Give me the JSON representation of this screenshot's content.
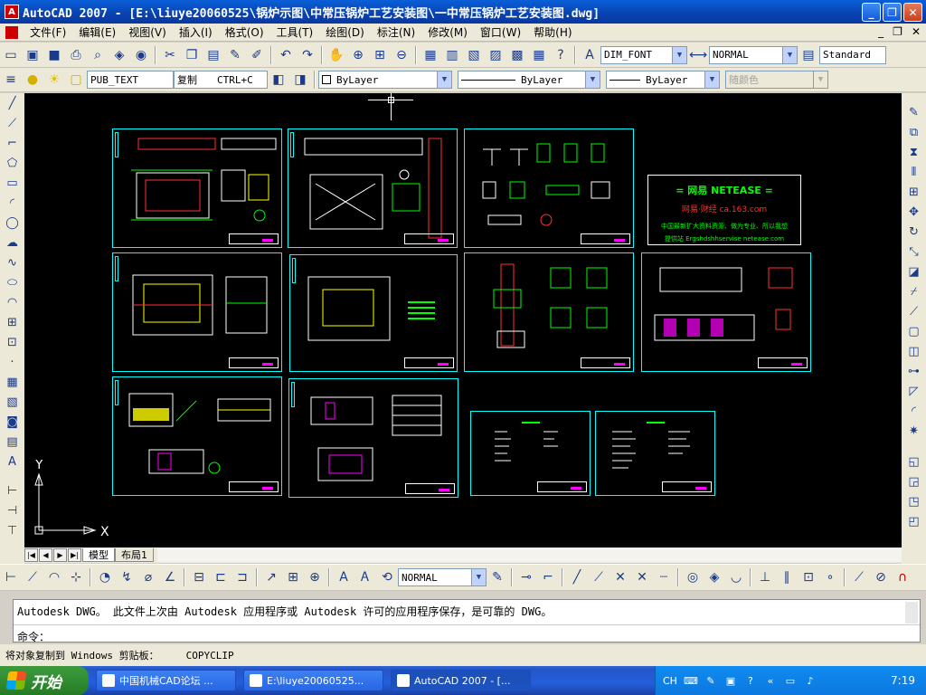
{
  "window": {
    "title": "AutoCAD 2007 - [E:\\liuye20060525\\锅炉示图\\中常压锅炉工艺安装图\\一中常压锅炉工艺安装图.dwg]",
    "app_icon_label": "A",
    "buttons": {
      "minimize": "_",
      "restore": "❐",
      "close": "✕"
    }
  },
  "menu": {
    "items": [
      "文件(F)",
      "编辑(E)",
      "视图(V)",
      "插入(I)",
      "格式(O)",
      "工具(T)",
      "绘图(D)",
      "标注(N)",
      "修改(M)",
      "窗口(W)",
      "帮助(H)"
    ],
    "mdi": {
      "minimize": "_",
      "restore": "❐",
      "close": "✕"
    }
  },
  "toolbar1": {
    "text_style": "DIM_FONT",
    "dim_style": "NORMAL",
    "table_style": "Standard"
  },
  "toolbar2": {
    "layer": "PUB_TEXT",
    "clipboard_label": "复制",
    "clipboard_shortcut": "CTRL+C",
    "color": "ByLayer",
    "linetype": "ByLayer",
    "lineweight": "ByLayer",
    "plotstyle": "随颜色"
  },
  "netease": {
    "line1": "= 网易 NETEASE =",
    "line2": "网易·财经   ca.163.com",
    "line3": "中国最新扩大资料资源、做为专业、所以我想",
    "line4": "提供站 Ergshdshhservise netease.com"
  },
  "ucs": {
    "x_label": "X",
    "y_label": "Y"
  },
  "layout_tabs": {
    "model": "模型",
    "layout1": "布局1"
  },
  "toolbar3": {
    "dim_style": "NORMAL"
  },
  "command": {
    "history": "Autodesk DWG。  此文件上次由 Autodesk 应用程序或 Autodesk 许可的应用程序保存，是可靠的 DWG。",
    "prompt": "命令："
  },
  "status": {
    "message": "将对象复制到 Windows 剪贴板：",
    "command": "COPYCLIP"
  },
  "taskbar": {
    "start": "开始",
    "tasks": [
      "中国机械CAD论坛 ...",
      "E:\\liuye20060525...",
      "AutoCAD 2007 - [..."
    ],
    "lang": "CH",
    "clock": "7:19"
  },
  "colors": {
    "sheet_border": "#00ffff",
    "canvas_bg": "#000000",
    "accent_magenta": "#ff00ff"
  }
}
